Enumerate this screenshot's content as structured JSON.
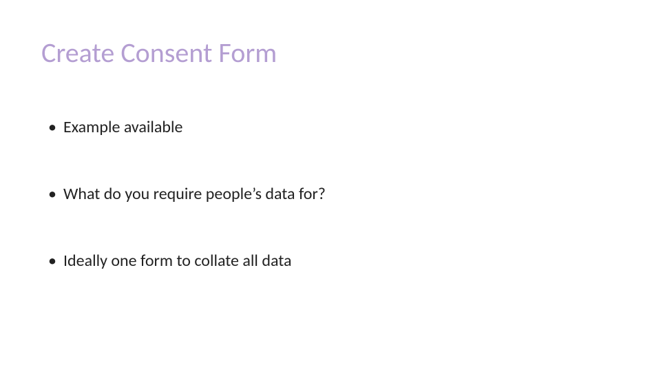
{
  "title": "Create Consent Form",
  "bullets": [
    "Example available",
    "What do you require people’s data for?",
    "Ideally one form to collate all data"
  ]
}
